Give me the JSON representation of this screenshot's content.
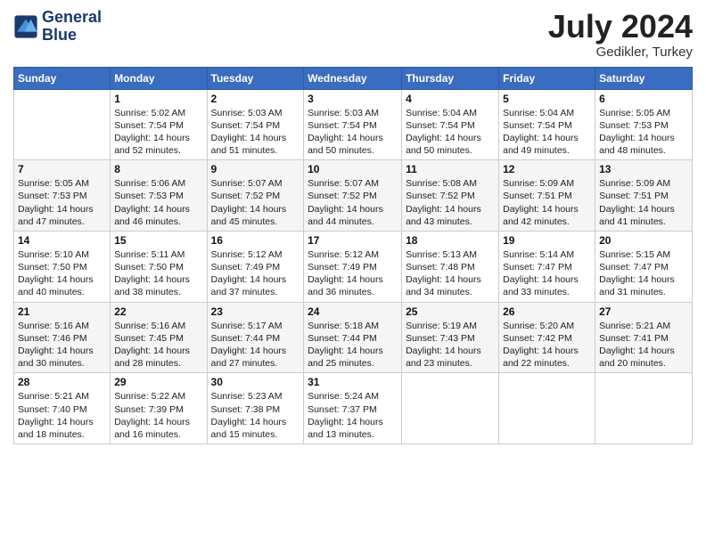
{
  "header": {
    "logo_line1": "General",
    "logo_line2": "Blue",
    "month_year": "July 2024",
    "location": "Gedikler, Turkey"
  },
  "days_of_week": [
    "Sunday",
    "Monday",
    "Tuesday",
    "Wednesday",
    "Thursday",
    "Friday",
    "Saturday"
  ],
  "weeks": [
    [
      {
        "day": "",
        "empty": true
      },
      {
        "day": "1",
        "sunrise": "Sunrise: 5:02 AM",
        "sunset": "Sunset: 7:54 PM",
        "daylight": "Daylight: 14 hours and 52 minutes."
      },
      {
        "day": "2",
        "sunrise": "Sunrise: 5:03 AM",
        "sunset": "Sunset: 7:54 PM",
        "daylight": "Daylight: 14 hours and 51 minutes."
      },
      {
        "day": "3",
        "sunrise": "Sunrise: 5:03 AM",
        "sunset": "Sunset: 7:54 PM",
        "daylight": "Daylight: 14 hours and 50 minutes."
      },
      {
        "day": "4",
        "sunrise": "Sunrise: 5:04 AM",
        "sunset": "Sunset: 7:54 PM",
        "daylight": "Daylight: 14 hours and 50 minutes."
      },
      {
        "day": "5",
        "sunrise": "Sunrise: 5:04 AM",
        "sunset": "Sunset: 7:54 PM",
        "daylight": "Daylight: 14 hours and 49 minutes."
      },
      {
        "day": "6",
        "sunrise": "Sunrise: 5:05 AM",
        "sunset": "Sunset: 7:53 PM",
        "daylight": "Daylight: 14 hours and 48 minutes."
      }
    ],
    [
      {
        "day": "7",
        "sunrise": "Sunrise: 5:05 AM",
        "sunset": "Sunset: 7:53 PM",
        "daylight": "Daylight: 14 hours and 47 minutes."
      },
      {
        "day": "8",
        "sunrise": "Sunrise: 5:06 AM",
        "sunset": "Sunset: 7:53 PM",
        "daylight": "Daylight: 14 hours and 46 minutes."
      },
      {
        "day": "9",
        "sunrise": "Sunrise: 5:07 AM",
        "sunset": "Sunset: 7:52 PM",
        "daylight": "Daylight: 14 hours and 45 minutes."
      },
      {
        "day": "10",
        "sunrise": "Sunrise: 5:07 AM",
        "sunset": "Sunset: 7:52 PM",
        "daylight": "Daylight: 14 hours and 44 minutes."
      },
      {
        "day": "11",
        "sunrise": "Sunrise: 5:08 AM",
        "sunset": "Sunset: 7:52 PM",
        "daylight": "Daylight: 14 hours and 43 minutes."
      },
      {
        "day": "12",
        "sunrise": "Sunrise: 5:09 AM",
        "sunset": "Sunset: 7:51 PM",
        "daylight": "Daylight: 14 hours and 42 minutes."
      },
      {
        "day": "13",
        "sunrise": "Sunrise: 5:09 AM",
        "sunset": "Sunset: 7:51 PM",
        "daylight": "Daylight: 14 hours and 41 minutes."
      }
    ],
    [
      {
        "day": "14",
        "sunrise": "Sunrise: 5:10 AM",
        "sunset": "Sunset: 7:50 PM",
        "daylight": "Daylight: 14 hours and 40 minutes."
      },
      {
        "day": "15",
        "sunrise": "Sunrise: 5:11 AM",
        "sunset": "Sunset: 7:50 PM",
        "daylight": "Daylight: 14 hours and 38 minutes."
      },
      {
        "day": "16",
        "sunrise": "Sunrise: 5:12 AM",
        "sunset": "Sunset: 7:49 PM",
        "daylight": "Daylight: 14 hours and 37 minutes."
      },
      {
        "day": "17",
        "sunrise": "Sunrise: 5:12 AM",
        "sunset": "Sunset: 7:49 PM",
        "daylight": "Daylight: 14 hours and 36 minutes."
      },
      {
        "day": "18",
        "sunrise": "Sunrise: 5:13 AM",
        "sunset": "Sunset: 7:48 PM",
        "daylight": "Daylight: 14 hours and 34 minutes."
      },
      {
        "day": "19",
        "sunrise": "Sunrise: 5:14 AM",
        "sunset": "Sunset: 7:47 PM",
        "daylight": "Daylight: 14 hours and 33 minutes."
      },
      {
        "day": "20",
        "sunrise": "Sunrise: 5:15 AM",
        "sunset": "Sunset: 7:47 PM",
        "daylight": "Daylight: 14 hours and 31 minutes."
      }
    ],
    [
      {
        "day": "21",
        "sunrise": "Sunrise: 5:16 AM",
        "sunset": "Sunset: 7:46 PM",
        "daylight": "Daylight: 14 hours and 30 minutes."
      },
      {
        "day": "22",
        "sunrise": "Sunrise: 5:16 AM",
        "sunset": "Sunset: 7:45 PM",
        "daylight": "Daylight: 14 hours and 28 minutes."
      },
      {
        "day": "23",
        "sunrise": "Sunrise: 5:17 AM",
        "sunset": "Sunset: 7:44 PM",
        "daylight": "Daylight: 14 hours and 27 minutes."
      },
      {
        "day": "24",
        "sunrise": "Sunrise: 5:18 AM",
        "sunset": "Sunset: 7:44 PM",
        "daylight": "Daylight: 14 hours and 25 minutes."
      },
      {
        "day": "25",
        "sunrise": "Sunrise: 5:19 AM",
        "sunset": "Sunset: 7:43 PM",
        "daylight": "Daylight: 14 hours and 23 minutes."
      },
      {
        "day": "26",
        "sunrise": "Sunrise: 5:20 AM",
        "sunset": "Sunset: 7:42 PM",
        "daylight": "Daylight: 14 hours and 22 minutes."
      },
      {
        "day": "27",
        "sunrise": "Sunrise: 5:21 AM",
        "sunset": "Sunset: 7:41 PM",
        "daylight": "Daylight: 14 hours and 20 minutes."
      }
    ],
    [
      {
        "day": "28",
        "sunrise": "Sunrise: 5:21 AM",
        "sunset": "Sunset: 7:40 PM",
        "daylight": "Daylight: 14 hours and 18 minutes."
      },
      {
        "day": "29",
        "sunrise": "Sunrise: 5:22 AM",
        "sunset": "Sunset: 7:39 PM",
        "daylight": "Daylight: 14 hours and 16 minutes."
      },
      {
        "day": "30",
        "sunrise": "Sunrise: 5:23 AM",
        "sunset": "Sunset: 7:38 PM",
        "daylight": "Daylight: 14 hours and 15 minutes."
      },
      {
        "day": "31",
        "sunrise": "Sunrise: 5:24 AM",
        "sunset": "Sunset: 7:37 PM",
        "daylight": "Daylight: 14 hours and 13 minutes."
      },
      {
        "day": "",
        "empty": true
      },
      {
        "day": "",
        "empty": true
      },
      {
        "day": "",
        "empty": true
      }
    ]
  ]
}
